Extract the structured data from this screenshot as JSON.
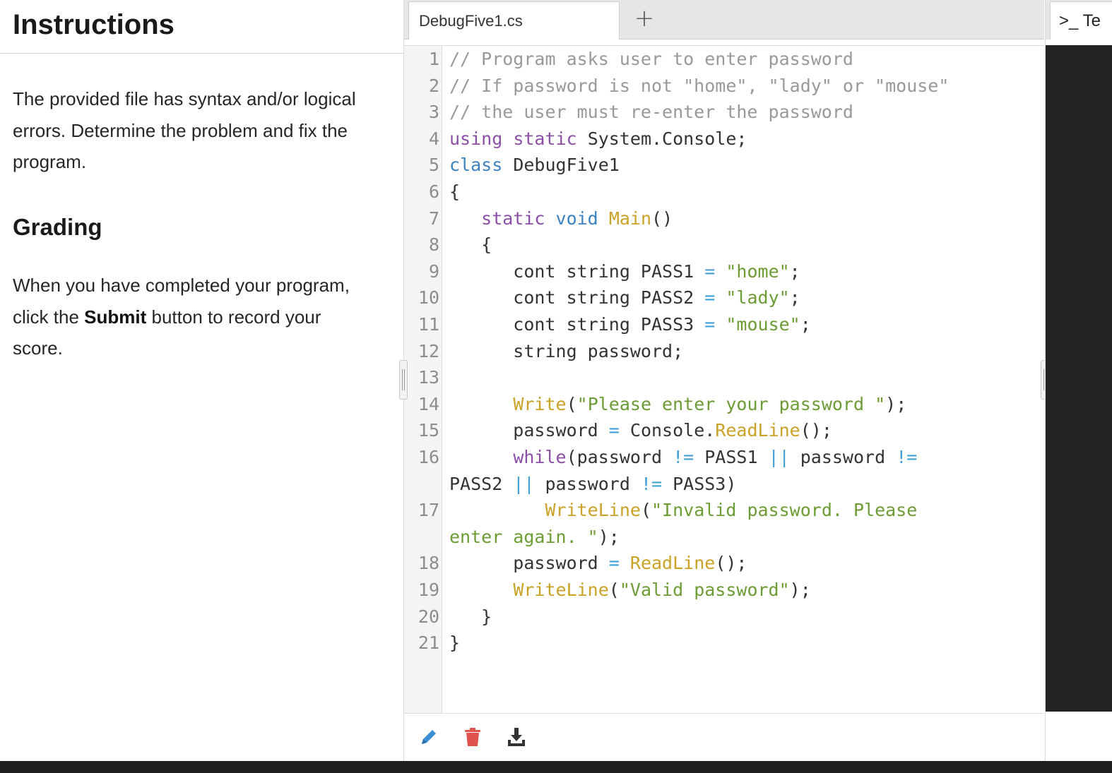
{
  "instructions": {
    "title": "Instructions",
    "para1": "The provided file has syntax and/or logical errors. Determine the problem and fix the program.",
    "grading_heading": "Grading",
    "para2_before": "When you have completed your program, click the ",
    "para2_bold": "Submit",
    "para2_after": " button to record your score."
  },
  "editor": {
    "file_tab": "DebugFive1.cs",
    "add_tab_symbol": "+",
    "code": [
      {
        "n": "1",
        "tokens": [
          [
            "cmt",
            "// Program asks user to enter password"
          ]
        ]
      },
      {
        "n": "2",
        "tokens": [
          [
            "cmt",
            "// If password is not \"home\", \"lady\" or \"mouse\""
          ]
        ]
      },
      {
        "n": "3",
        "tokens": [
          [
            "cmt",
            "// the user must re-enter the password"
          ]
        ]
      },
      {
        "n": "4",
        "tokens": [
          [
            "kw-p",
            "using"
          ],
          [
            "pl",
            " "
          ],
          [
            "kw-p",
            "static"
          ],
          [
            "pl",
            " System.Console;"
          ]
        ]
      },
      {
        "n": "5",
        "tokens": [
          [
            "kw-b",
            "class"
          ],
          [
            "pl",
            " DebugFive1"
          ]
        ]
      },
      {
        "n": "6",
        "tokens": [
          [
            "pl",
            "{"
          ]
        ]
      },
      {
        "n": "7",
        "tokens": [
          [
            "pl",
            "   "
          ],
          [
            "kw-p",
            "static"
          ],
          [
            "pl",
            " "
          ],
          [
            "kw-b",
            "void"
          ],
          [
            "pl",
            " "
          ],
          [
            "fn",
            "Main"
          ],
          [
            "pl",
            "()"
          ]
        ]
      },
      {
        "n": "8",
        "tokens": [
          [
            "pl",
            "   {"
          ]
        ]
      },
      {
        "n": "9",
        "tokens": [
          [
            "pl",
            "      cont string PASS1 "
          ],
          [
            "op",
            "="
          ],
          [
            "pl",
            " "
          ],
          [
            "str",
            "\"home\""
          ],
          [
            "pl",
            ";"
          ]
        ]
      },
      {
        "n": "10",
        "tokens": [
          [
            "pl",
            "      cont string PASS2 "
          ],
          [
            "op",
            "="
          ],
          [
            "pl",
            " "
          ],
          [
            "str",
            "\"lady\""
          ],
          [
            "pl",
            ";"
          ]
        ]
      },
      {
        "n": "11",
        "tokens": [
          [
            "pl",
            "      cont string PASS3 "
          ],
          [
            "op",
            "="
          ],
          [
            "pl",
            " "
          ],
          [
            "str",
            "\"mouse\""
          ],
          [
            "pl",
            ";"
          ]
        ]
      },
      {
        "n": "12",
        "tokens": [
          [
            "pl",
            "      string password;"
          ]
        ]
      },
      {
        "n": "13",
        "tokens": [
          [
            "pl",
            ""
          ]
        ]
      },
      {
        "n": "14",
        "tokens": [
          [
            "pl",
            "      "
          ],
          [
            "fn",
            "Write"
          ],
          [
            "pl",
            "("
          ],
          [
            "str",
            "\"Please enter your password \""
          ],
          [
            "pl",
            ");"
          ]
        ]
      },
      {
        "n": "15",
        "tokens": [
          [
            "pl",
            "      password "
          ],
          [
            "op",
            "="
          ],
          [
            "pl",
            " Console."
          ],
          [
            "fn",
            "ReadLine"
          ],
          [
            "pl",
            "();"
          ]
        ]
      },
      {
        "n": "16",
        "tokens": [
          [
            "pl",
            "      "
          ],
          [
            "kw-p",
            "while"
          ],
          [
            "pl",
            "(password "
          ],
          [
            "op",
            "!="
          ],
          [
            "pl",
            " PASS1 "
          ],
          [
            "op",
            "||"
          ],
          [
            "pl",
            " password "
          ],
          [
            "op",
            "!="
          ]
        ]
      },
      {
        "n": "",
        "tokens": [
          [
            "pl",
            "PASS2 "
          ],
          [
            "op",
            "||"
          ],
          [
            "pl",
            " password "
          ],
          [
            "op",
            "!="
          ],
          [
            "pl",
            " PASS3)"
          ]
        ]
      },
      {
        "n": "17",
        "tokens": [
          [
            "pl",
            "         "
          ],
          [
            "fn",
            "WriteLine"
          ],
          [
            "pl",
            "("
          ],
          [
            "str",
            "\"Invalid password. Please"
          ]
        ]
      },
      {
        "n": "",
        "tokens": [
          [
            "str",
            "enter again. \""
          ],
          [
            "pl",
            ");"
          ]
        ]
      },
      {
        "n": "18",
        "tokens": [
          [
            "pl",
            "      password "
          ],
          [
            "op",
            "="
          ],
          [
            "pl",
            " "
          ],
          [
            "fn",
            "ReadLine"
          ],
          [
            "pl",
            "();"
          ]
        ]
      },
      {
        "n": "19",
        "tokens": [
          [
            "pl",
            "      "
          ],
          [
            "fn",
            "WriteLine"
          ],
          [
            "pl",
            "("
          ],
          [
            "str",
            "\"Valid password\""
          ],
          [
            "pl",
            ");"
          ]
        ]
      },
      {
        "n": "20",
        "tokens": [
          [
            "pl",
            "   }"
          ]
        ]
      },
      {
        "n": "21",
        "tokens": [
          [
            "pl",
            "}"
          ]
        ]
      }
    ],
    "toolbar": {
      "edit_icon": "pencil-icon",
      "delete_icon": "trash-icon",
      "download_icon": "download-icon",
      "edit_color": "#3b8fd4",
      "delete_color": "#e0524c",
      "download_color": "#333333"
    }
  },
  "terminal": {
    "tab_label": ">_ Te"
  }
}
